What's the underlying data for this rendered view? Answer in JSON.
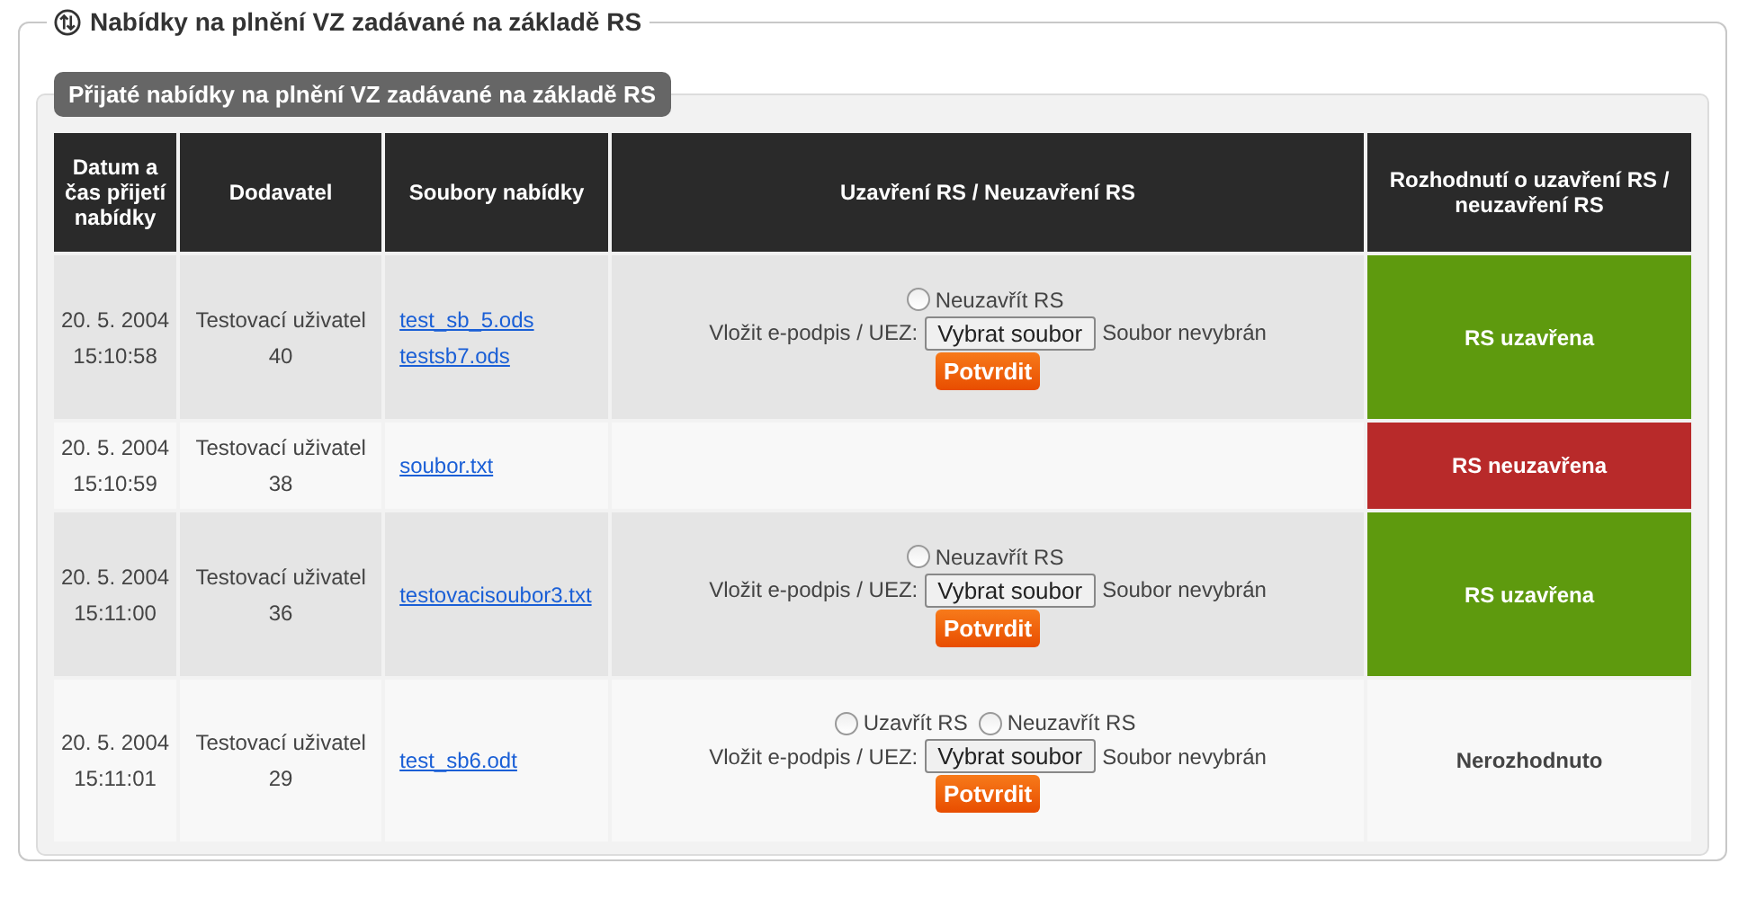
{
  "section": {
    "title": "Nabídky na plnění VZ zadávané na základě RS"
  },
  "panel": {
    "title": "Přijaté nabídky na plnění VZ zadávané na základě RS"
  },
  "table": {
    "columns": [
      "Datum a čas přijetí nabídky",
      "Dodavatel",
      "Soubory nabídky",
      "Uzavření RS / Neuzavření RS",
      "Rozhodnutí o uzavření RS / neuzavření RS"
    ],
    "rows": [
      {
        "date": "20. 5. 2004",
        "time": "15:10:58",
        "supplier": "Testovací uživatel",
        "supplier_no": "40",
        "files": [
          "test_sb_5.ods",
          "testsb7.ods"
        ],
        "action": {
          "options": [
            {
              "label": "Neuzavřít RS",
              "checked": false
            }
          ],
          "upload_label": "Vložit e-podpis / UEZ:",
          "upload_button": "Vybrat soubor",
          "upload_status": "Soubor nevybrán",
          "confirm": "Potvrdit"
        },
        "decision": {
          "text": "RS uzavřena",
          "kind": "closed"
        }
      },
      {
        "date": "20. 5. 2004",
        "time": "15:10:59",
        "supplier": "Testovací uživatel",
        "supplier_no": "38",
        "files": [
          "soubor.txt"
        ],
        "decision": {
          "text": "RS neuzavřena",
          "kind": "rejected"
        }
      },
      {
        "date": "20. 5. 2004",
        "time": "15:11:00",
        "supplier": "Testovací uživatel",
        "supplier_no": "36",
        "files": [
          "testovacisoubor3.txt"
        ],
        "action": {
          "options": [
            {
              "label": "Neuzavřít RS",
              "checked": false
            }
          ],
          "upload_label": "Vložit e-podpis / UEZ:",
          "upload_button": "Vybrat soubor",
          "upload_status": "Soubor nevybrán",
          "confirm": "Potvrdit"
        },
        "decision": {
          "text": "RS uzavřena",
          "kind": "closed"
        }
      },
      {
        "date": "20. 5. 2004",
        "time": "15:11:01",
        "supplier": "Testovací uživatel",
        "supplier_no": "29",
        "files": [
          "test_sb6.odt"
        ],
        "action": {
          "options": [
            {
              "label": "Uzavřít RS",
              "checked": false
            },
            {
              "label": "Neuzavřít RS",
              "checked": false
            }
          ],
          "upload_label": "Vložit e-podpis / UEZ:",
          "upload_button": "Vybrat soubor",
          "upload_status": "Soubor nevybrán",
          "confirm": "Potvrdit"
        },
        "decision": {
          "text": "Nerozhodnuto",
          "kind": "undecided"
        }
      }
    ]
  }
}
